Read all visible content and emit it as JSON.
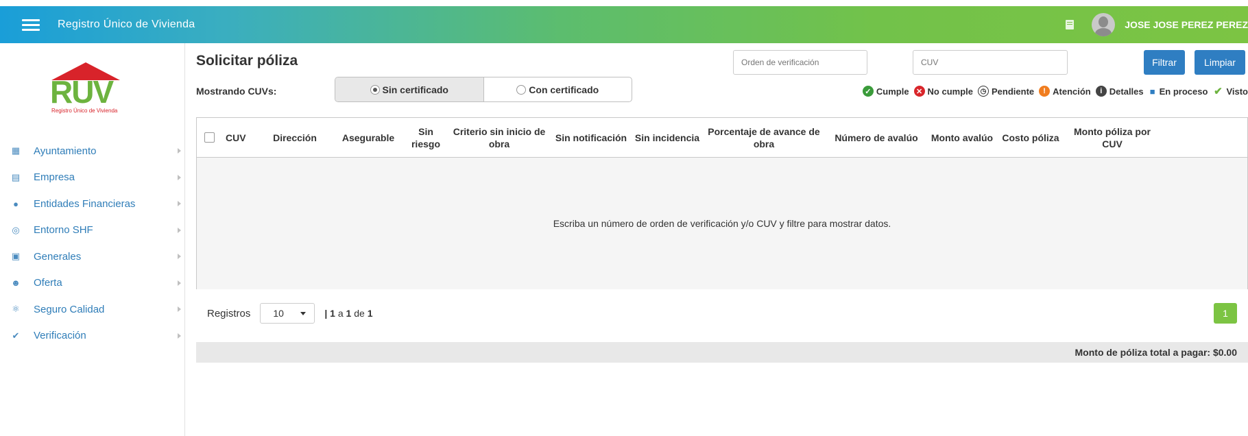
{
  "header": {
    "app_title": "Registro Único de Vivienda",
    "user_name": "JOSE JOSE PEREZ PEREZ"
  },
  "logo": {
    "text": "RUV",
    "subtitle": "Registro Único de Vivienda"
  },
  "sidebar": {
    "items": [
      {
        "label": "Ayuntamiento",
        "icon": "map-icon"
      },
      {
        "label": "Empresa",
        "icon": "building-icon"
      },
      {
        "label": "Entidades Financieras",
        "icon": "people-icon"
      },
      {
        "label": "Entorno SHF",
        "icon": "target-icon"
      },
      {
        "label": "Generales",
        "icon": "image-icon"
      },
      {
        "label": "Oferta",
        "icon": "hand-icon"
      },
      {
        "label": "Seguro Calidad",
        "icon": "handshake-icon"
      },
      {
        "label": "Verificación",
        "icon": "check-circle-icon"
      }
    ]
  },
  "main": {
    "title": "Solicitar póliza",
    "showing_label": "Mostrando CUVs:",
    "toggle": {
      "option1": "Sin certificado",
      "option2": "Con certificado",
      "selected": "Sin certificado"
    },
    "filters": {
      "order_placeholder": "Orden de verificación",
      "cuv_placeholder": "CUV",
      "filter_button": "Filtrar",
      "clear_button": "Limpiar"
    },
    "legend": [
      {
        "label": "Cumple",
        "color": "#3a9b3a",
        "icon": "check-circle-icon"
      },
      {
        "label": "No cumple",
        "color": "#d9262b",
        "icon": "x-circle-icon"
      },
      {
        "label": "Pendiente",
        "color": "#333333",
        "icon": "clock-icon"
      },
      {
        "label": "Atención",
        "color": "#f07d1f",
        "icon": "alert-circle-icon"
      },
      {
        "label": "Detalles",
        "color": "#444444",
        "icon": "info-circle-icon"
      },
      {
        "label": "En proceso",
        "color": "#2f7ec2",
        "icon": "lock-icon"
      },
      {
        "label": "Visto",
        "color": "#6db33f",
        "icon": "checkmark-icon"
      }
    ],
    "table": {
      "columns": [
        "CUV",
        "Dirección",
        "Asegurable",
        "Sin riesgo",
        "Criterio sin inicio de obra",
        "Sin notificación",
        "Sin incidencia",
        "Porcentaje de avance de obra",
        "Número de avalúo",
        "Monto avalúo",
        "Costo póliza",
        "Monto póliza por CUV"
      ],
      "empty_message": "Escriba un número de orden de verificación y/o CUV y filtre para mostrar datos."
    },
    "pager": {
      "label": "Registros",
      "page_size": "10",
      "sep": "|",
      "from": "1",
      "a": "a",
      "to": "1",
      "de": "de",
      "total": "1",
      "current_page": "1"
    },
    "total_label": "Monto de póliza total a pagar: $0.00"
  }
}
